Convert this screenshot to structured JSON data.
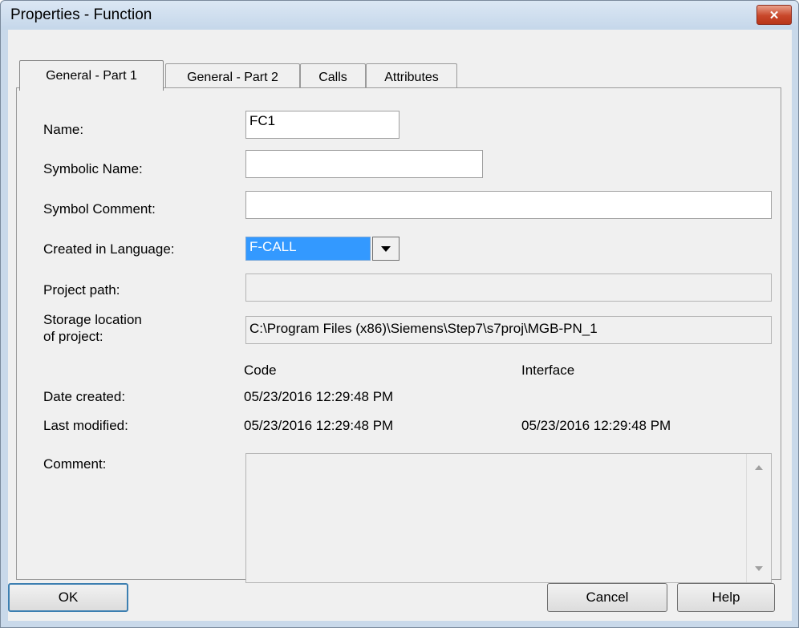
{
  "window": {
    "title": "Properties - Function",
    "close_glyph": "✕"
  },
  "tabs": [
    {
      "label": "General - Part 1",
      "active": true
    },
    {
      "label": "General - Part 2",
      "active": false
    },
    {
      "label": "Calls",
      "active": false
    },
    {
      "label": "Attributes",
      "active": false
    }
  ],
  "form": {
    "name_label": "Name:",
    "name_value": "FC1",
    "symbolic_name_label": "Symbolic Name:",
    "symbolic_name_value": "",
    "symbol_comment_label": "Symbol Comment:",
    "symbol_comment_value": "",
    "language_label": "Created in Language:",
    "language_value": "F-CALL",
    "project_path_label": "Project path:",
    "project_path_value": "",
    "storage_label_line1": "Storage location",
    "storage_label_line2": "of project:",
    "storage_value": "C:\\Program Files (x86)\\Siemens\\Step7\\s7proj\\MGB-PN_1",
    "code_header": "Code",
    "interface_header": "Interface",
    "date_created_label": "Date created:",
    "date_created_code": "05/23/2016 12:29:48 PM",
    "last_modified_label": "Last modified:",
    "last_modified_code": "05/23/2016 12:29:48 PM",
    "last_modified_interface": "05/23/2016 12:29:48 PM",
    "comment_label": "Comment:",
    "comment_value": ""
  },
  "buttons": {
    "ok": "OK",
    "cancel": "Cancel",
    "help": "Help"
  },
  "icons": {
    "dropdown": "chevron-down-icon",
    "close": "close-icon",
    "scroll_up": "scroll-up-icon",
    "scroll_down": "scroll-down-icon"
  }
}
